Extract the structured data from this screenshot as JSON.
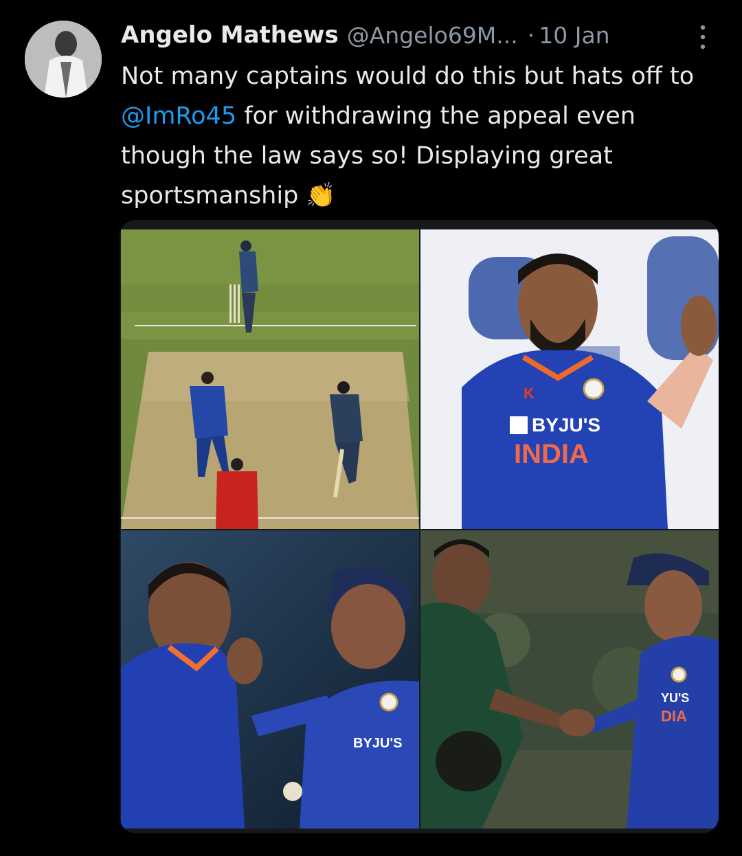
{
  "tweet": {
    "author_name": "Angelo Mathews",
    "handle": "@Angelo69M...",
    "separator": "·",
    "date": "10 Jan",
    "text_before_mention": "Not many captains would do this but hats off to ",
    "mention": "@ImRo45",
    "text_after_mention": " for withdrawing the appeal even though the law says so! Displaying great sportsmanship ",
    "emoji": "👏"
  },
  "media": {
    "tiles": [
      {
        "name": "cricket-pitch-photo"
      },
      {
        "name": "bowler-smiling-photo",
        "jersey_sponsor": "BYJU'S",
        "jersey_team": "INDIA",
        "jersey_brand": "K"
      },
      {
        "name": "players-laughing-photo",
        "jersey_sponsor": "BYJU'S"
      },
      {
        "name": "handshake-photo",
        "jersey_sponsor": "YU'S",
        "jersey_team": "DIA"
      }
    ]
  },
  "colors": {
    "background": "#000000",
    "text": "#e7e9ea",
    "secondary": "#8b98a5",
    "link": "#1d9bf0"
  },
  "icons": {
    "more": "more-vertical-icon",
    "avatar": "avatar-photo"
  }
}
